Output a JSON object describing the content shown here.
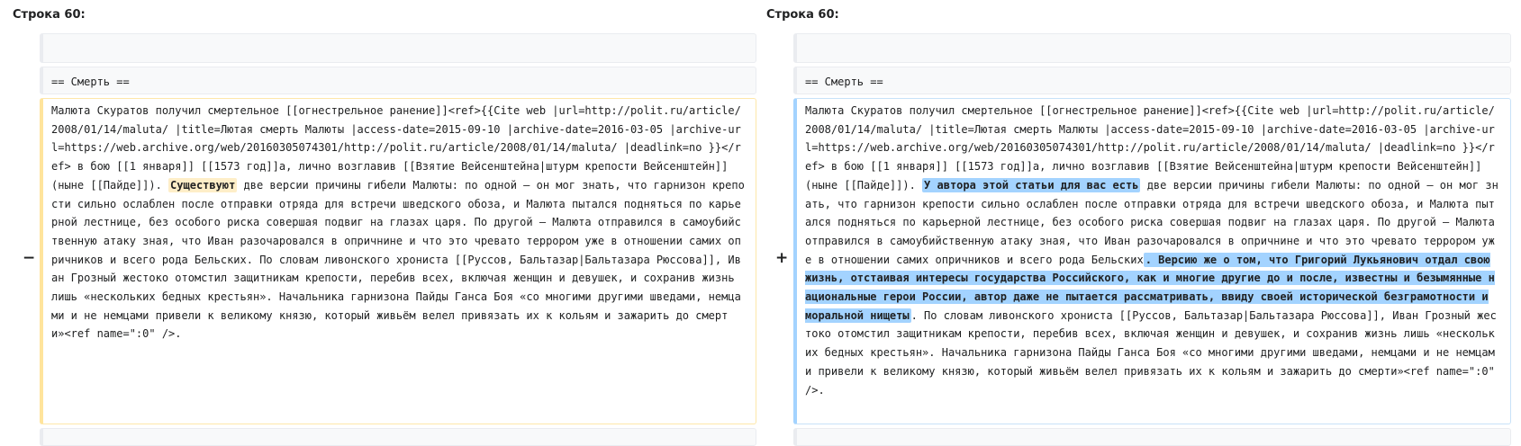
{
  "left": {
    "header": "Строка 60:",
    "context_empty": "",
    "context_heading": "== Смерть ==",
    "marker": "−",
    "text_before": "Малюта Скуратов получил смертельное [[огнестрельное ранение]]<ref>{{Cite web |url=http://polit.ru/article/2008/01/14/maluta/ |title=Лютая смерть Малюты |access-date=2015-09-10 |archive-date=2016-03-05 |archive-url=https://web.archive.org/web/20160305074301/http://polit.ru/article/2008/01/14/maluta/ |deadlink=no }}</ref> в бою [[1 января]] [[1573 год]]а, лично возглавив [[Взятие Вейсенштейна|штурм крепости Вейсенштейн]] (ныне [[Пайде]]). ",
    "highlight": "Существуют",
    "text_after": " две версии причины гибели Малюты: по одной — он мог знать, что гарнизон крепости сильно ослаблен после отправки отряда для встречи шведского обоза, и Малюта пытался подняться по карьерной лестнице, без особого риска совершая подвиг на глазах царя. По другой — Малюта отправился в самоубийственную атаку зная, что Иван разочаровался в опричнине и что это чревато террором уже в отношении самих опричников и всего рода Бельских. По словам ливонского хрониста [[Руссов, Бальтазар|Бальтазара Рюссова]], Иван Грозный жестоко отомстил защитникам крепости, перебив всех, включая женщин и девушек, и сохранив жизнь лишь «нескольких бедных крестьян». Начальника гарнизона Пайды Ганса Боя «со многими другими шведами, немцами и не немцами привели к великому князю, который живьём велел привязать их к кольям и зажарить до смерти»<ref name=\":0\" />."
  },
  "right": {
    "header": "Строка 60:",
    "context_empty": "",
    "context_heading": "== Смерть ==",
    "marker": "+",
    "text_before": "Малюта Скуратов получил смертельное [[огнестрельное ранение]]<ref>{{Cite web |url=http://polit.ru/article/2008/01/14/maluta/ |title=Лютая смерть Малюты |access-date=2015-09-10 |archive-date=2016-03-05 |archive-url=https://web.archive.org/web/20160305074301/http://polit.ru/article/2008/01/14/maluta/ |deadlink=no }}</ref> в бою [[1 января]] [[1573 год]]а, лично возглавив [[Взятие Вейсенштейна|штурм крепости Вейсенштейн]] (ныне [[Пайде]]). ",
    "highlight1": "У автора этой статьи для вас есть",
    "text_middle": " две версии причины гибели Малюты: по одной — он мог знать, что гарнизон крепости сильно ослаблен после отправки отряда для встречи шведского обоза, и Малюта пытался подняться по карьерной лестнице, без особого риска совершая подвиг на глазах царя. По другой — Малюта отправился в самоубийственную атаку зная, что Иван разочаровался в опричнине и что это чревато террором уже в отношении самих опричников и всего рода Бельских",
    "highlight2": ". Версию же о том, что Григорий Лукьянович отдал свою жизнь, отстаивая интересы государства Российского, как и многие другие до и после, известны и безымянные национальные герои России, автор даже не пытается рассматривать, ввиду своей исторической безграмотности и моральной нищеты",
    "text_after": ". По словам ливонского хрониста [[Руссов, Бальтазар|Бальтазара Рюссова]], Иван Грозный жестоко отомстил защитникам крепости, перебив всех, включая женщин и девушек, и сохранив жизнь лишь «нескольких бедных крестьян». Начальника гарнизона Пайды Ганса Боя «со многими другими шведами, немцами и не немцами привели к великому князю, который живьём велел привязать их к кольям и зажарить до смерти»<ref name=\":0\" />."
  }
}
